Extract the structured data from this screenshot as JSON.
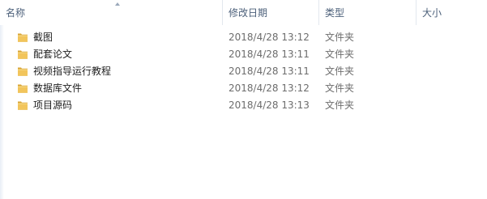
{
  "header": {
    "columns": [
      {
        "label": "名称"
      },
      {
        "label": "修改日期"
      },
      {
        "label": "类型"
      },
      {
        "label": "大小"
      }
    ]
  },
  "files": [
    {
      "name": "截图",
      "date": "2018/4/28 13:12",
      "type": "文件夹",
      "size": "",
      "icon": "folder-icon"
    },
    {
      "name": "配套论文",
      "date": "2018/4/28 13:11",
      "type": "文件夹",
      "size": "",
      "icon": "folder-icon"
    },
    {
      "name": "视频指导运行教程",
      "date": "2018/4/28 13:11",
      "type": "文件夹",
      "size": "",
      "icon": "folder-icon"
    },
    {
      "name": "数据库文件",
      "date": "2018/4/28 13:12",
      "type": "文件夹",
      "size": "",
      "icon": "folder-icon"
    },
    {
      "name": "项目源码",
      "date": "2018/4/28 13:13",
      "type": "文件夹",
      "size": "",
      "icon": "folder-icon"
    }
  ],
  "colors": {
    "header_text": "#4c607a",
    "name_text": "#1e1e1e",
    "detail_text": "#6d6d6d",
    "folder_body": "#f2c55c",
    "folder_dark": "#d9a534"
  }
}
